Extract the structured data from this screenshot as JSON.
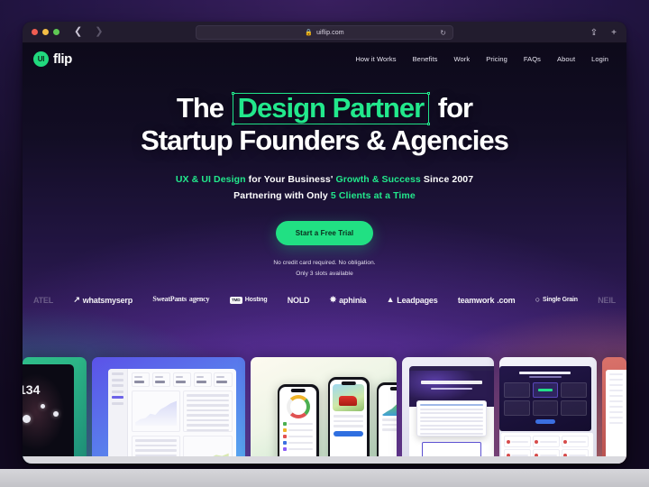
{
  "browser": {
    "url": "uiflip.com",
    "lock_icon": "lock-icon",
    "reload_icon": "reload-icon",
    "back_icon": "chevron-left-icon",
    "forward_icon": "chevron-right-icon",
    "share_icon": "share-icon",
    "new_tab_icon": "plus-icon",
    "traffic_lights": [
      "close",
      "minimize",
      "maximize"
    ]
  },
  "site": {
    "logo": {
      "mark": "UI",
      "word": "flip"
    },
    "nav": [
      {
        "label": "How it Works"
      },
      {
        "label": "Benefits"
      },
      {
        "label": "Work"
      },
      {
        "label": "Pricing"
      },
      {
        "label": "FAQs"
      },
      {
        "label": "About"
      },
      {
        "label": "Login"
      }
    ]
  },
  "hero": {
    "headline": {
      "line1_before": "The",
      "line1_highlight": "Design Partner",
      "line1_after": "for",
      "line2": "Startup Founders & Agencies"
    },
    "sub_line1_a": "UX & UI Design",
    "sub_line1_b": "for Your Business'",
    "sub_line1_c": "Growth & Success",
    "sub_line1_d": "Since 2007",
    "sub_line2_a": "Partnering with Only",
    "sub_line2_b": "5 Clients at a Time",
    "cta_label": "Start a Free Trial",
    "fineprint_line1": "No credit card required. No obligation.",
    "fineprint_line2": "Only 3 slots available"
  },
  "logos": [
    {
      "name": "ATEL",
      "style": "fade"
    },
    {
      "name": "whatsmyserp",
      "style": "normal",
      "glyph": "↗"
    },
    {
      "name": "SweatPants",
      "name2": "agency",
      "style": "serif"
    },
    {
      "name": "Hosting",
      "chip": "TMD",
      "style": "small"
    },
    {
      "name": "NOLD",
      "style": "normal"
    },
    {
      "name": "aphinia",
      "style": "normal",
      "glyph": "✸"
    },
    {
      "name": "Leadpages",
      "style": "normal",
      "glyph": "▲"
    },
    {
      "name": "teamwork",
      "suffix": ".com",
      "style": "normal"
    },
    {
      "name": "Single Grain",
      "style": "small",
      "glyph": "○"
    },
    {
      "name": "NEIL",
      "style": "fade"
    }
  ],
  "showcase": {
    "card1_number": "134",
    "cards": [
      {
        "label": "space-game-app"
      },
      {
        "label": "analytics-dashboard"
      },
      {
        "label": "mobile-apps"
      },
      {
        "label": "serp-rank-tracking-site"
      },
      {
        "label": "pricing-page-design"
      },
      {
        "label": "edge-card"
      }
    ]
  },
  "colors": {
    "accent_green": "#22e88c",
    "cta_green": "#21e083",
    "bg_purple": "#241646",
    "bg_dark": "#0d0a1a"
  }
}
